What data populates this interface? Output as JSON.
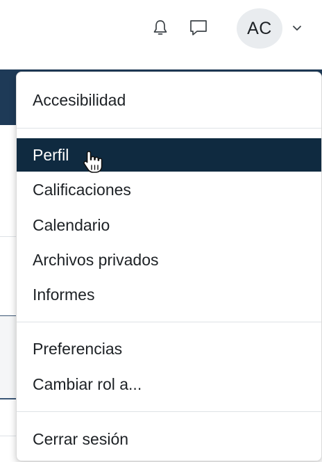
{
  "header": {
    "avatar_initials": "AC",
    "icons": [
      "bell-icon",
      "chat-icon",
      "chevron-down-icon"
    ]
  },
  "menu": {
    "items": [
      {
        "label": "Accesibilidad"
      },
      {
        "label": "Perfil",
        "active": true
      },
      {
        "label": "Calificaciones"
      },
      {
        "label": "Calendario"
      },
      {
        "label": "Archivos privados"
      },
      {
        "label": "Informes"
      },
      {
        "label": "Preferencias"
      },
      {
        "label": "Cambiar rol a..."
      },
      {
        "label": "Cerrar sesión"
      }
    ]
  },
  "colors": {
    "active_item_bg": "#0f2a40",
    "page_header_bg": "#1e3a57",
    "avatar_bg": "#e9ecef"
  }
}
